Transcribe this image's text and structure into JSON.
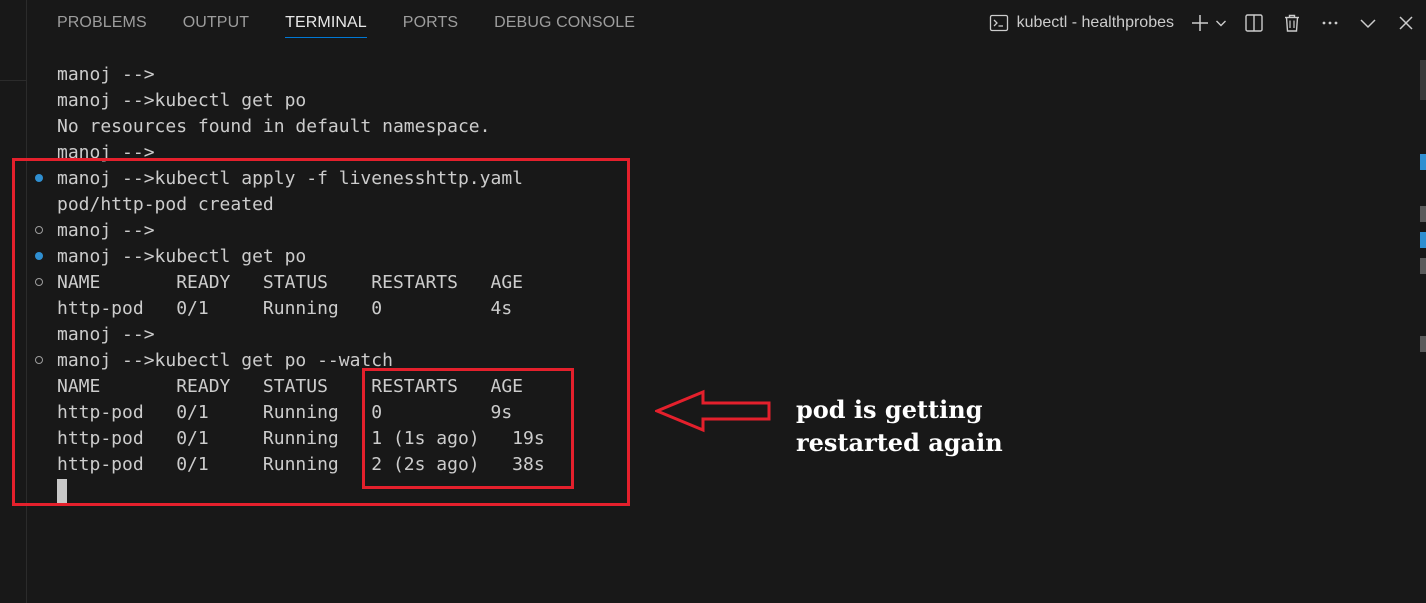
{
  "tabs": [
    "PROBLEMS",
    "OUTPUT",
    "TERMINAL",
    "PORTS",
    "DEBUG CONSOLE"
  ],
  "active_tab": "TERMINAL",
  "terminal_name": "kubectl - healthprobes",
  "icons": {
    "terminal": "terminal-icon",
    "new_terminal": "plus-icon",
    "launch_profile": "chevron-down-icon",
    "split": "split-terminal-icon",
    "kill": "trash-icon",
    "more": "more-icon",
    "maximize": "chevron-up-icon",
    "close": "close-icon"
  },
  "terminal": {
    "lines": [
      {
        "text": "manoj -->",
        "decoration": "none"
      },
      {
        "text": "manoj -->kubectl get po",
        "decoration": "none"
      },
      {
        "text": "No resources found in default namespace.",
        "decoration": "none"
      },
      {
        "text": "manoj -->",
        "decoration": "none"
      },
      {
        "text": "manoj -->kubectl apply -f livenesshttp.yaml",
        "decoration": "success"
      },
      {
        "text": "pod/http-pod created",
        "decoration": "none"
      },
      {
        "text": "manoj -->",
        "decoration": "default"
      },
      {
        "text": "manoj -->kubectl get po",
        "decoration": "success"
      },
      {
        "text": "NAME       READY   STATUS    RESTARTS   AGE",
        "decoration": "default"
      },
      {
        "text": "http-pod   0/1     Running   0          4s",
        "decoration": "none"
      },
      {
        "text": "manoj -->",
        "decoration": "none"
      },
      {
        "text": "manoj -->kubectl get po --watch",
        "decoration": "default"
      },
      {
        "text": "NAME       READY   STATUS    RESTARTS   AGE",
        "decoration": "none"
      },
      {
        "text": "http-pod   0/1     Running   0          9s",
        "decoration": "none"
      },
      {
        "text": "http-pod   0/1     Running   1 (1s ago)   19s",
        "decoration": "none"
      },
      {
        "text": "http-pod   0/1     Running   2 (2s ago)   38s",
        "decoration": "none"
      }
    ]
  },
  "annotation": {
    "line1": "pod is getting",
    "line2": "restarted again",
    "color": "#e4202c"
  },
  "colors": {
    "background": "#181818",
    "text": "#cccccc",
    "success_decoration": "#2f8fd1",
    "active_tab_underline": "#0078d4"
  }
}
